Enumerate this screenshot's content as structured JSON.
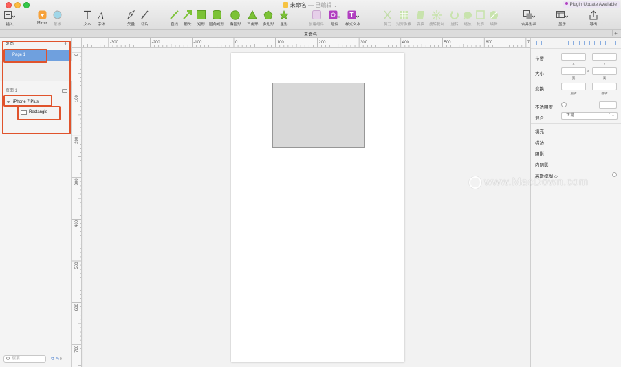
{
  "window": {
    "title": "未命名",
    "status": "— 已编辑 ⌄",
    "plugin_update": "Plugin Update Available"
  },
  "toolbar": {
    "tools": [
      {
        "label": "插入",
        "icon": "insert-icon",
        "enabled": true
      },
      {
        "label": "Mirror",
        "icon": "mirror-icon",
        "enabled": true
      },
      {
        "label": "蒙板",
        "icon": "mask-icon",
        "enabled": false
      },
      {
        "label": "文本",
        "icon": "text-icon",
        "enabled": true
      },
      {
        "label": "字体",
        "icon": "font-icon",
        "enabled": true
      },
      {
        "label": "矢量",
        "icon": "vector-icon",
        "enabled": true
      },
      {
        "label": "切片",
        "icon": "slice-icon",
        "enabled": true
      },
      {
        "label": "直线",
        "icon": "line-icon",
        "enabled": true
      },
      {
        "label": "箭头",
        "icon": "arrow-icon",
        "enabled": true
      },
      {
        "label": "矩形",
        "icon": "rectangle-icon",
        "enabled": true
      },
      {
        "label": "圆角矩形",
        "icon": "rounded-rect-icon",
        "enabled": true
      },
      {
        "label": "椭圆形",
        "icon": "oval-icon",
        "enabled": true
      },
      {
        "label": "三角形",
        "icon": "triangle-icon",
        "enabled": true
      },
      {
        "label": "多边形",
        "icon": "polygon-icon",
        "enabled": true
      },
      {
        "label": "星形",
        "icon": "star-icon",
        "enabled": true
      },
      {
        "label": "创建组件",
        "icon": "create-symbol-icon",
        "enabled": false
      },
      {
        "label": "组件",
        "icon": "symbol-icon",
        "enabled": true
      },
      {
        "label": "样式文本",
        "icon": "text-style-icon",
        "enabled": true
      },
      {
        "label": "剪刀",
        "icon": "scissors-icon",
        "enabled": false
      },
      {
        "label": "对齐像素",
        "icon": "round-pixel-icon",
        "enabled": false
      },
      {
        "label": "变换",
        "icon": "transform-icon",
        "enabled": false
      },
      {
        "label": "旋转复制",
        "icon": "rotate-copies-icon",
        "enabled": false
      },
      {
        "label": "旋转",
        "icon": "rotate-icon",
        "enabled": false
      },
      {
        "label": "缩放",
        "icon": "scale-icon",
        "enabled": false
      },
      {
        "label": "轮廓",
        "icon": "outline-icon",
        "enabled": false
      },
      {
        "label": "编辑",
        "icon": "edit-icon",
        "enabled": false
      },
      {
        "label": "合并形状",
        "icon": "combine-shapes-icon",
        "enabled": true
      },
      {
        "label": "显示",
        "icon": "view-icon",
        "enabled": true
      },
      {
        "label": "导出",
        "icon": "export-icon",
        "enabled": true
      }
    ]
  },
  "tabbar": {
    "title": "未命名",
    "add": "+"
  },
  "left_panel": {
    "pages_header": "页面",
    "add": "+",
    "pages": [
      {
        "name": "Page 1",
        "selected": true
      }
    ],
    "current_page_caption": "页面 1",
    "layers": [
      {
        "name": "iPhone 7 Plus",
        "type": "artboard"
      },
      {
        "name": "Rectangle",
        "type": "shape"
      }
    ],
    "search_placeholder": "搜索",
    "footer_count": "0"
  },
  "ruler": {
    "top_labels": [
      "-300",
      "-200",
      "-100",
      "0",
      "100",
      "200",
      "300",
      "400",
      "500",
      "600",
      "700"
    ],
    "left_labels": [
      "0",
      "100",
      "200",
      "300",
      "400",
      "500",
      "600",
      "700"
    ]
  },
  "canvas": {
    "artboard_name": "iPhone 7 Plus",
    "shape_name": "Rectangle",
    "artboard_color": "#ffffff",
    "shape_fill": "#d8d8d8",
    "shape_border": "#979797"
  },
  "inspector": {
    "position": "位置",
    "pos_x": "X",
    "pos_y": "Y",
    "size": "大小",
    "width": "宽",
    "height": "高",
    "transform": "变换",
    "rotate": "旋转",
    "flip": "翻转",
    "opacity": "不透明度",
    "blend": "混合",
    "blend_value": "正常",
    "fills": "填充",
    "borders": "描边",
    "shadows": "阴影",
    "inner_shadows": "内阴影",
    "blur": "高斯模糊 ◇"
  },
  "watermark": "www.MacDown.com",
  "colors": {
    "accent": "#6fa0de",
    "highlight": "#e0532c",
    "shape_green": "#7cc236",
    "symbol_purple": "#b13fc0"
  }
}
